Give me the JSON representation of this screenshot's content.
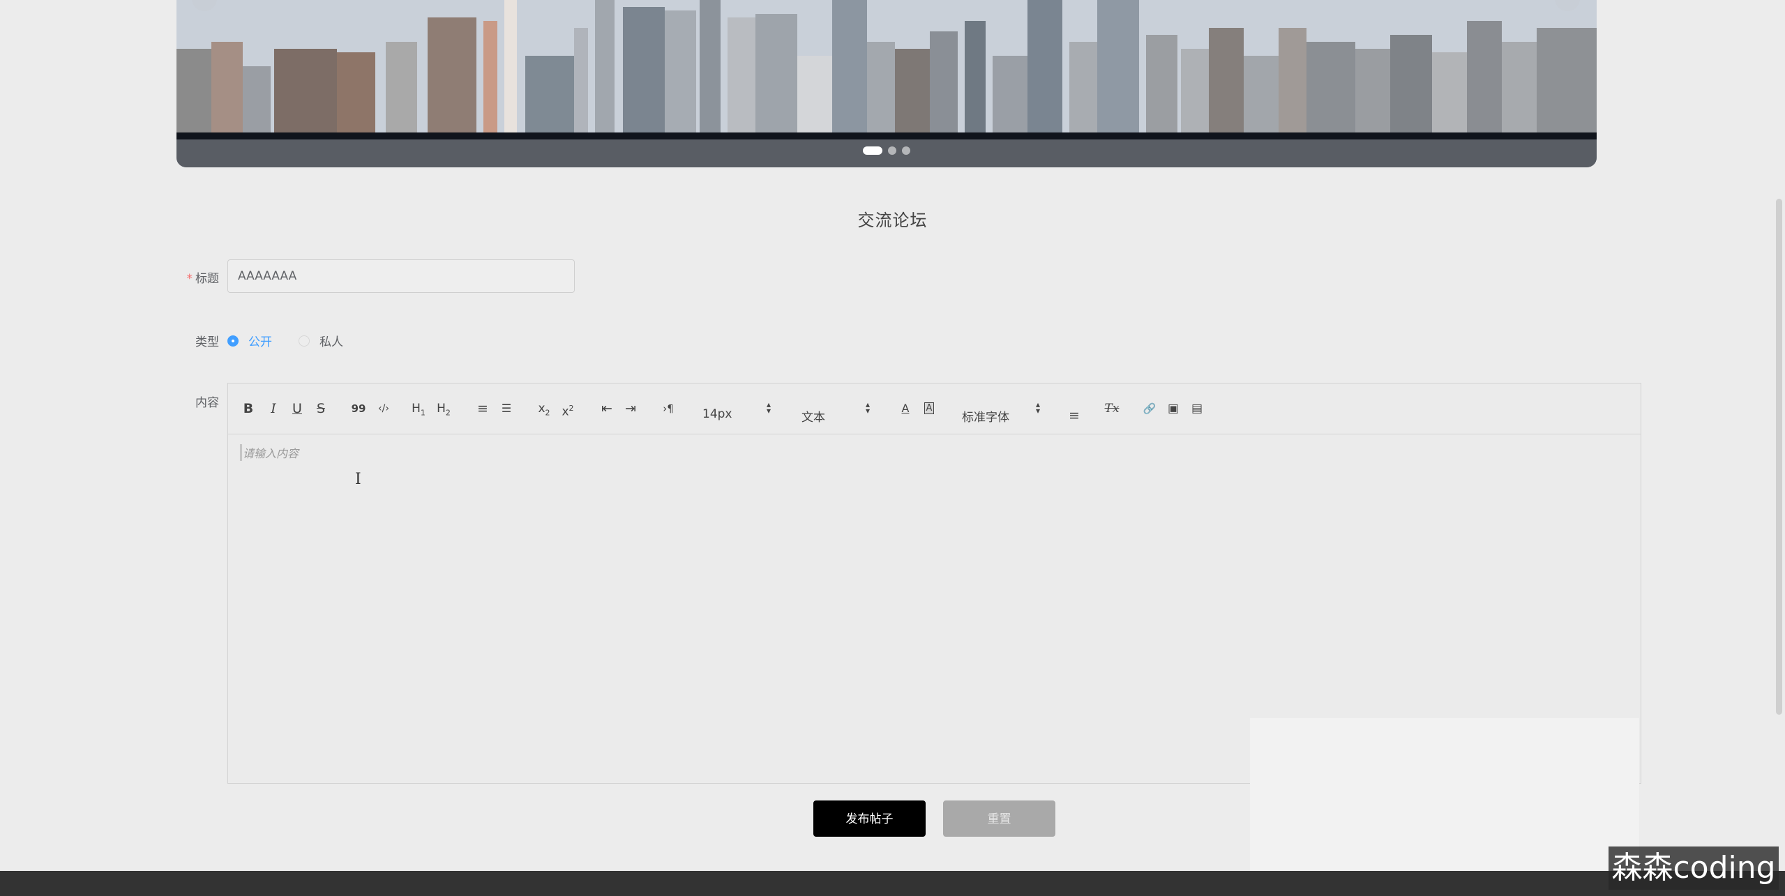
{
  "banner": {
    "alt": "city skyline carousel",
    "slide_count": 3,
    "active_slide": 1
  },
  "page_title": "交流论坛",
  "form": {
    "title_label": "标题",
    "title_required_mark": "*",
    "title_value": "AAAAAAA",
    "type_label": "类型",
    "type_options": [
      "公开",
      "私人"
    ],
    "type_selected": "公开",
    "content_label": "内容"
  },
  "editor": {
    "toolbar": {
      "bold": "B",
      "italic": "I",
      "underline": "U",
      "strike": "S",
      "blockquote": "99",
      "code": "‹/›",
      "h1": "H",
      "h1_sub": "1",
      "h2": "H",
      "h2_sub": "2",
      "ordered_list": "≡",
      "bullet_list": "☰",
      "subscript": "x",
      "subscript_sub": "2",
      "superscript": "x",
      "superscript_sup": "2",
      "outdent": "⇤",
      "indent": "⇥",
      "direction": "›¶",
      "size_value": "14px",
      "header_value": "文本",
      "color": "A",
      "background": "A",
      "font_value": "标准字体",
      "align": "≡",
      "clean": "Tx",
      "link": "🔗",
      "image": "▣",
      "video": "▤"
    },
    "placeholder": "请输入内容",
    "cursor": "I"
  },
  "buttons": {
    "submit": "发布帖子",
    "reset": "重置"
  },
  "watermark": "森森coding",
  "colors": {
    "primary": "#409eff",
    "button_dark": "#000000",
    "required": "#f56c6c"
  }
}
